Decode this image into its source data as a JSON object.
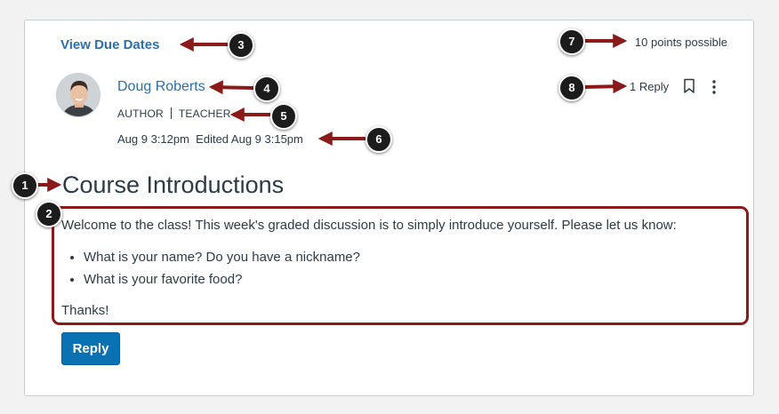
{
  "header": {
    "view_due_dates": "View Due Dates",
    "points_possible": "10 points possible"
  },
  "author": {
    "name": "Doug Roberts",
    "role_1": "AUTHOR",
    "role_2": "TEACHER",
    "dates": "Aug 9 3:12pm  Edited Aug 9 3:15pm"
  },
  "actions": {
    "reply_count": "1 Reply"
  },
  "discussion": {
    "title": "Course Introductions",
    "intro": "Welcome to the class! This week's graded discussion is to simply introduce yourself. Please let us know:",
    "questions": [
      "What is your name? Do you have a nickname?",
      "What is your favorite food?"
    ],
    "outro": "Thanks!"
  },
  "reply_button": "Reply",
  "callouts": [
    "1",
    "2",
    "3",
    "4",
    "5",
    "6",
    "7",
    "8"
  ],
  "colors": {
    "link": "#2d6fa8",
    "text": "#2d3b45",
    "primary_button": "#0a71b3",
    "annotation": "#8b1a1a"
  }
}
